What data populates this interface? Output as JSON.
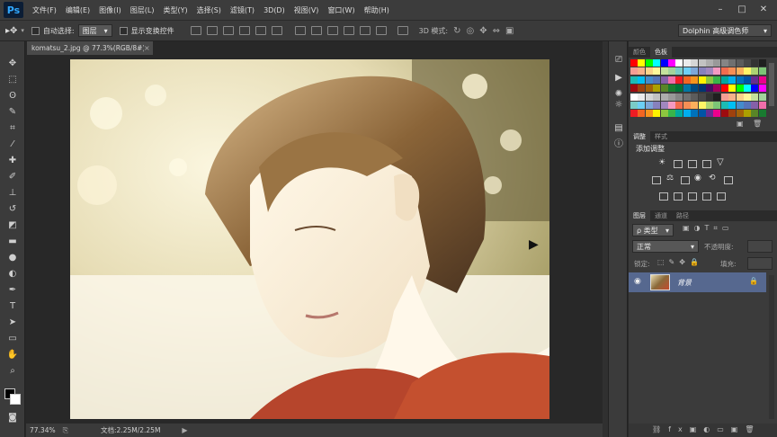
{
  "menubar": {
    "logo": "Ps",
    "items": [
      "文件(F)",
      "编辑(E)",
      "图像(I)",
      "图层(L)",
      "类型(Y)",
      "选择(S)",
      "滤镜(T)",
      "3D(D)",
      "视图(V)",
      "窗口(W)",
      "帮助(H)"
    ],
    "window_buttons": [
      "–",
      "□",
      "✕"
    ]
  },
  "options": {
    "auto_select_label": "自动选择:",
    "auto_select_value": "图层",
    "show_transform_label": "显示变换控件",
    "mode_3d_label": "3D 模式:",
    "workspace_value": "Dolphin 高级调色师"
  },
  "document": {
    "tab_title": "komatsu_2.jpg @ 77.3%(RGB/8#)",
    "close": "×",
    "zoom": "77.34%",
    "doc_info": "文档:2.25M/2.25M"
  },
  "swatches_panel": {
    "tabs": [
      "颜色",
      "色板"
    ],
    "colors": [
      "#ff0000",
      "#ffff00",
      "#00ff00",
      "#00ffff",
      "#0000ff",
      "#ff00ff",
      "#ffffff",
      "#ebebeb",
      "#d6d6d6",
      "#c2c2c2",
      "#adadad",
      "#999999",
      "#858585",
      "#707070",
      "#5c5c5c",
      "#474747",
      "#333333",
      "#1f1f1f",
      "#f59e94",
      "#f7b28a",
      "#fbd38a",
      "#fff79a",
      "#c5e19c",
      "#a3d39c",
      "#7accc8",
      "#6dcff6",
      "#7da7d9",
      "#8781bd",
      "#a187be",
      "#f49ac1",
      "#f26c4f",
      "#f68e55",
      "#fbaf5c",
      "#fff467",
      "#acd372",
      "#7cc576",
      "#1cbbb4",
      "#00bff3",
      "#448ccb",
      "#5674b9",
      "#8560a8",
      "#f06eaa",
      "#ed1c24",
      "#f26522",
      "#f7941d",
      "#fff200",
      "#8dc63f",
      "#39b54a",
      "#00a99d",
      "#00aeef",
      "#0072bc",
      "#0054a6",
      "#662d91",
      "#ec008c",
      "#9e0b0f",
      "#a0410d",
      "#a36209",
      "#aba000",
      "#598527",
      "#197b30",
      "#007236",
      "#0076a3",
      "#004a80",
      "#003471",
      "#440e62",
      "#9e005d"
    ]
  },
  "adjustments_panel": {
    "tabs": [
      "调整",
      "样式"
    ],
    "title": "添加调整"
  },
  "layers_panel": {
    "tabs": [
      "图层",
      "通道",
      "路径"
    ],
    "filter_label": "ρ 类型",
    "blend_mode": "正常",
    "opacity_label": "不透明度:",
    "lock_label": "锁定:",
    "fill_label": "填充:",
    "layer_name": "背景"
  },
  "icons": {
    "tools": [
      "move-icon",
      "marquee-icon",
      "lasso-icon",
      "quick-select-icon",
      "crop-icon",
      "eyedropper-icon",
      "healing-icon",
      "brush-icon",
      "stamp-icon",
      "history-brush-icon",
      "eraser-icon",
      "gradient-icon",
      "blur-icon",
      "dodge-icon",
      "pen-icon",
      "type-icon",
      "path-select-icon",
      "shape-icon",
      "hand-icon",
      "zoom-icon"
    ]
  }
}
